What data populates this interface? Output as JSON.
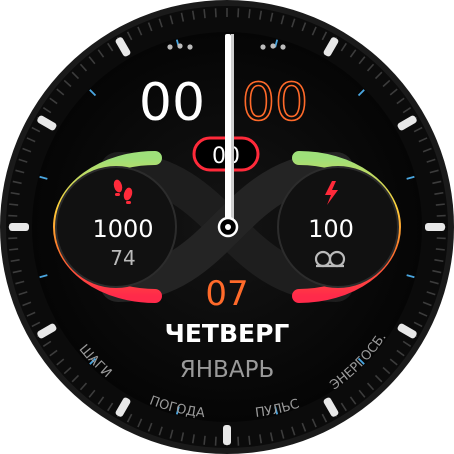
{
  "time": {
    "hours": "00",
    "minutes": "00",
    "seconds": "00"
  },
  "date": {
    "day": "07",
    "weekday": "ЧЕТВЕРГ",
    "month": "ЯНВАРЬ"
  },
  "left_complication": {
    "icon": "footsteps-icon",
    "value": "1000",
    "sub": "74",
    "level": 0.5
  },
  "right_complication": {
    "icon": "lightning-icon",
    "value": "100",
    "level": 0.5
  },
  "shortcuts": {
    "steps": "ШАГИ",
    "weather": "ПОГОДА",
    "pulse": "ПУЛЬС",
    "energy": "ЭНЕРГОСБ."
  },
  "colors": {
    "background": "#000000",
    "accent": "#ff6a2a",
    "white": "#ffffff",
    "tick_blue": "#4aa6e0",
    "gauge_gradient": [
      "#ff2a4a",
      "#ff7a2a",
      "#ffd23a",
      "#9ee07a"
    ]
  }
}
